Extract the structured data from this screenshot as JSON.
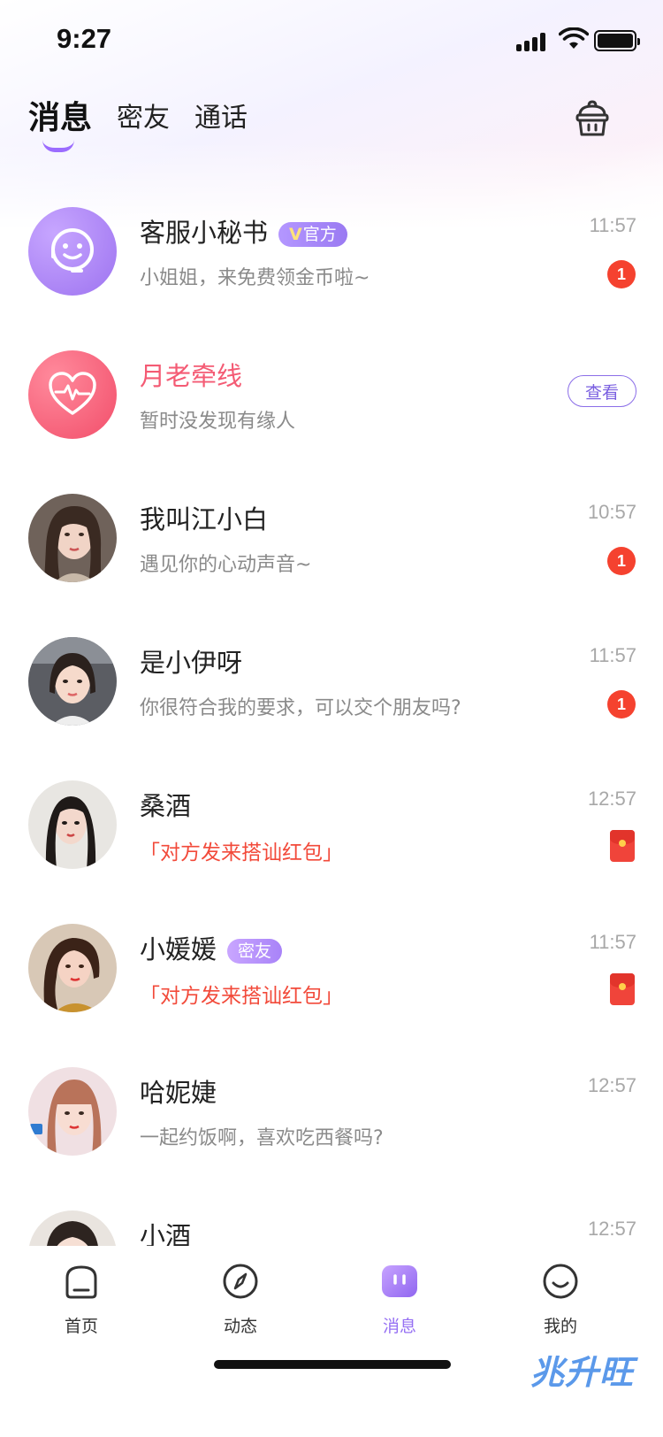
{
  "status_bar": {
    "time": "9:27"
  },
  "header": {
    "tabs": [
      {
        "label": "消息",
        "active": true
      },
      {
        "label": "密友",
        "active": false
      },
      {
        "label": "通话",
        "active": false
      }
    ],
    "right_icon": "basket-icon"
  },
  "messages": [
    {
      "name": "客服小秘书",
      "tag_v": "V",
      "tag": "官方",
      "preview": "小姐姐，来免费领金币啦~",
      "time": "11:57",
      "unread": "1",
      "avatar": "headset-smiley-icon"
    },
    {
      "name": "月老牵线",
      "preview": "暂时没发现有缘人",
      "button": "查看",
      "avatar": "heart-pulse-icon"
    },
    {
      "name": "我叫江小白",
      "preview": "遇见你的心动声音~",
      "time": "10:57",
      "unread": "1"
    },
    {
      "name": "是小伊呀",
      "preview": "你很符合我的要求，可以交个朋友吗?",
      "time": "11:57",
      "unread": "1"
    },
    {
      "name": "桑酒",
      "preview": "「对方发来搭讪红包」",
      "time": "12:57",
      "icon": "red-packet-icon"
    },
    {
      "name": "小媛媛",
      "tag": "密友",
      "preview": "「对方发来搭讪红包」",
      "time": "11:57",
      "icon": "red-packet-icon"
    },
    {
      "name": "哈妮婕",
      "preview": "一起约饭啊，喜欢吃西餐吗?",
      "time": "12:57"
    },
    {
      "name": "小酒",
      "time": "12:57"
    }
  ],
  "bottom_nav": [
    {
      "label": "首页",
      "icon": "home-icon",
      "active": false
    },
    {
      "label": "动态",
      "icon": "compass-icon",
      "active": false
    },
    {
      "label": "消息",
      "icon": "message-icon",
      "active": true
    },
    {
      "label": "我的",
      "icon": "smile-icon",
      "active": false
    }
  ],
  "watermark": "兆升旺",
  "colors": {
    "accent": "#9670f3",
    "badge": "#f5422f",
    "pink": "#f45b74",
    "red_text": "#f24a3a"
  }
}
